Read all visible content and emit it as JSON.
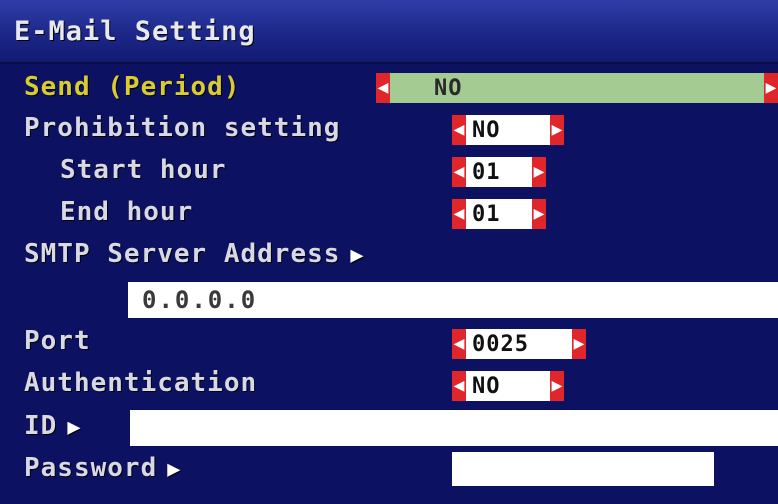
{
  "window": {
    "title": "E-Mail Setting"
  },
  "send_period": {
    "label": "Send (Period)",
    "value": "NO"
  },
  "prohibition": {
    "label": "Prohibition setting",
    "value": "NO"
  },
  "start_hour": {
    "label": "Start hour",
    "value": "01"
  },
  "end_hour": {
    "label": "End hour",
    "value": "01"
  },
  "smtp": {
    "label": "SMTP Server Address",
    "value": "0.0.0.0"
  },
  "port": {
    "label": "Port",
    "value": "0025"
  },
  "authentication": {
    "label": "Authentication",
    "value": "NO"
  },
  "id": {
    "label": "ID",
    "value": ""
  },
  "password": {
    "label": "Password",
    "value": ""
  },
  "icons": {
    "left_arrow": "◀",
    "right_arrow": "▶",
    "expand": "▶"
  },
  "colors": {
    "background": "#0d1162",
    "arrow_red": "#e0262b",
    "selected_green": "#a4cc92",
    "highlight_label": "#d8cc32"
  }
}
